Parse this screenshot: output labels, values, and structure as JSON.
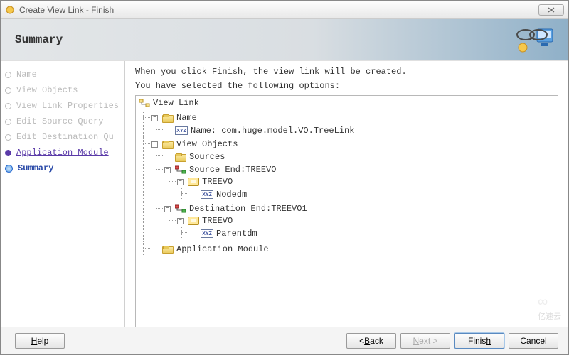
{
  "window": {
    "title": "Create View Link - Finish"
  },
  "banner": {
    "title": "Summary"
  },
  "sidebar": {
    "steps": [
      {
        "label": "Name"
      },
      {
        "label": "View Objects"
      },
      {
        "label": "View Link Properties"
      },
      {
        "label": "Edit Source Query"
      },
      {
        "label": "Edit Destination Qu"
      },
      {
        "label": "Application Module"
      },
      {
        "label": "Summary"
      }
    ]
  },
  "content": {
    "intro1": "When you click Finish, the view link will be created.",
    "intro2": "You have selected the following options:",
    "tree": {
      "root": "View Link",
      "name_folder": "Name",
      "name_value": "Name: com.huge.model.VO.TreeLink",
      "vo_folder": "View Objects",
      "sources_folder": "Sources",
      "source_end": "Source End:TREEVO",
      "source_obj": "TREEVO",
      "source_attr": "Nodedm",
      "dest_end": "Destination End:TREEVO1",
      "dest_obj": "TREEVO",
      "dest_attr": "Parentdm",
      "am_folder": "Application Module"
    }
  },
  "buttons": {
    "help": "Help",
    "back": "Back",
    "next": "Next",
    "finish": "Finish",
    "cancel": "Cancel"
  },
  "watermark": "亿速云"
}
